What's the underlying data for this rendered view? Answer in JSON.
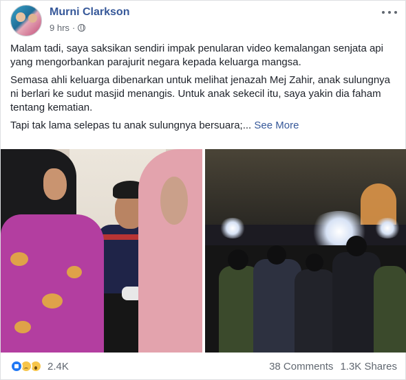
{
  "post": {
    "author": "Murni Clarkson",
    "time": "9 hrs",
    "dot": "·",
    "paragraphs": [
      "Malam tadi, saya saksikan sendiri impak penularan video kemalangan senjata api yang mengorbankan parajurit negara kepada keluarga mangsa.",
      "Semasa ahli keluarga dibenarkan untuk melihat jenazah Mej Zahir, anak sulungnya ni berlari ke sudut masjid menangis. Untuk anak sekecil itu, saya yakin dia faham tentang kematian.",
      "Tapi tak lama selepas tu anak sulungnya bersuara;..."
    ],
    "see_more": "See More"
  },
  "footer": {
    "reaction_count": "2.4K",
    "comments": "38 Comments",
    "shares": "1.3K Shares"
  },
  "icons": {
    "privacy": "globe-icon",
    "options": "more-options-icon",
    "reactions": [
      "like-icon",
      "sad-icon",
      "wow-icon"
    ]
  },
  "colors": {
    "author_link": "#365899",
    "meta_text": "#616770",
    "like_blue": "#2078f4"
  }
}
